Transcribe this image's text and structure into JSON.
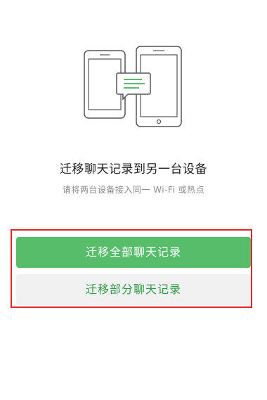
{
  "main": {
    "title": "迁移聊天记录到另一台设备",
    "subtitle": "请将两台设备接入同一 Wi-Fi 或热点"
  },
  "actions": {
    "migrate_all_label": "迁移全部聊天记录",
    "migrate_partial_label": "迁移部分聊天记录"
  },
  "colors": {
    "primary_green": "#57bd6a",
    "secondary_text_green": "#2e9a48",
    "highlight_frame_red": "#e0282b"
  },
  "icons": {
    "illustration": "two-phones-chat-transfer-icon"
  }
}
